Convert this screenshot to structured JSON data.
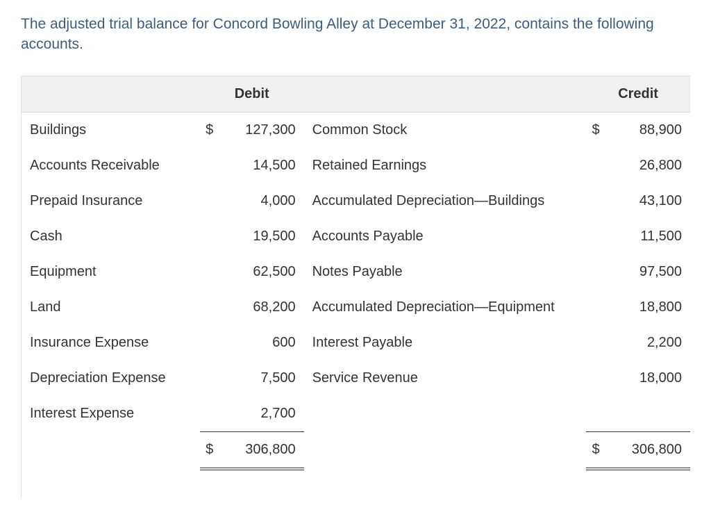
{
  "intro": "The adjusted trial balance for Concord Bowling Alley at December 31, 2022, contains the following accounts.",
  "headers": {
    "debit": "Debit",
    "credit": "Credit"
  },
  "rows": [
    {
      "debit_label": "Buildings",
      "debit_cur": "$",
      "debit_val": "127,300",
      "credit_label": "Common Stock",
      "credit_cur": "$",
      "credit_val": "88,900"
    },
    {
      "debit_label": "Accounts Receivable",
      "debit_cur": "",
      "debit_val": "14,500",
      "credit_label": "Retained Earnings",
      "credit_cur": "",
      "credit_val": "26,800"
    },
    {
      "debit_label": "Prepaid Insurance",
      "debit_cur": "",
      "debit_val": "4,000",
      "credit_label": "Accumulated Depreciation—Buildings",
      "credit_cur": "",
      "credit_val": "43,100"
    },
    {
      "debit_label": "Cash",
      "debit_cur": "",
      "debit_val": "19,500",
      "credit_label": "Accounts Payable",
      "credit_cur": "",
      "credit_val": "11,500"
    },
    {
      "debit_label": "Equipment",
      "debit_cur": "",
      "debit_val": "62,500",
      "credit_label": "Notes Payable",
      "credit_cur": "",
      "credit_val": "97,500"
    },
    {
      "debit_label": "Land",
      "debit_cur": "",
      "debit_val": "68,200",
      "credit_label": "Accumulated Depreciation—Equipment",
      "credit_cur": "",
      "credit_val": "18,800"
    },
    {
      "debit_label": "Insurance Expense",
      "debit_cur": "",
      "debit_val": "600",
      "credit_label": "Interest Payable",
      "credit_cur": "",
      "credit_val": "2,200"
    },
    {
      "debit_label": "Depreciation Expense",
      "debit_cur": "",
      "debit_val": "7,500",
      "credit_label": "Service Revenue",
      "credit_cur": "",
      "credit_val": "18,000"
    },
    {
      "debit_label": "Interest Expense",
      "debit_cur": "",
      "debit_val": "2,700",
      "credit_label": "",
      "credit_cur": "",
      "credit_val": ""
    }
  ],
  "totals": {
    "debit_cur": "$",
    "debit_val": "306,800",
    "credit_cur": "$",
    "credit_val": "306,800"
  },
  "chart_data": {
    "type": "table",
    "title": "Adjusted Trial Balance — Concord Bowling Alley, December 31, 2022",
    "debits": [
      {
        "account": "Buildings",
        "amount": 127300
      },
      {
        "account": "Accounts Receivable",
        "amount": 14500
      },
      {
        "account": "Prepaid Insurance",
        "amount": 4000
      },
      {
        "account": "Cash",
        "amount": 19500
      },
      {
        "account": "Equipment",
        "amount": 62500
      },
      {
        "account": "Land",
        "amount": 68200
      },
      {
        "account": "Insurance Expense",
        "amount": 600
      },
      {
        "account": "Depreciation Expense",
        "amount": 7500
      },
      {
        "account": "Interest Expense",
        "amount": 2700
      }
    ],
    "credits": [
      {
        "account": "Common Stock",
        "amount": 88900
      },
      {
        "account": "Retained Earnings",
        "amount": 26800
      },
      {
        "account": "Accumulated Depreciation—Buildings",
        "amount": 43100
      },
      {
        "account": "Accounts Payable",
        "amount": 11500
      },
      {
        "account": "Notes Payable",
        "amount": 97500
      },
      {
        "account": "Accumulated Depreciation—Equipment",
        "amount": 18800
      },
      {
        "account": "Interest Payable",
        "amount": 2200
      },
      {
        "account": "Service Revenue",
        "amount": 18000
      }
    ],
    "debit_total": 306800,
    "credit_total": 306800
  }
}
